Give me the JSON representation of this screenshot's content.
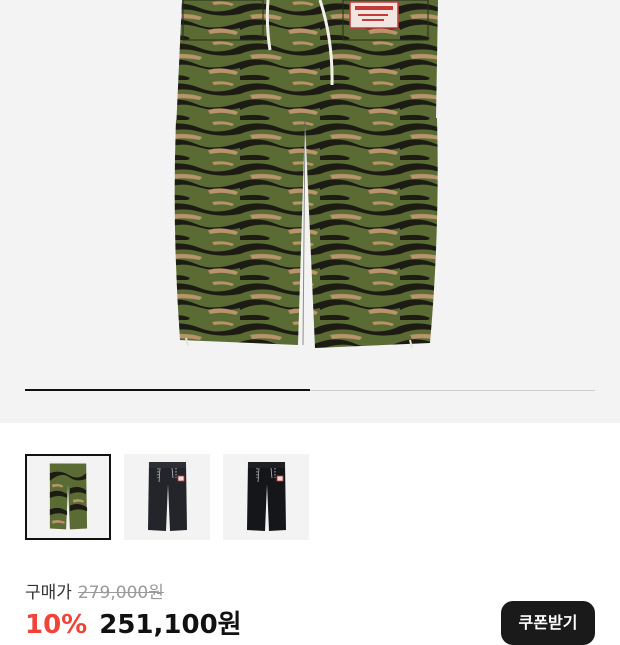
{
  "product": {
    "label_prefix": "구매가",
    "original_price": "279,000원",
    "discount": "10%",
    "sale_price": "251,100원",
    "coupon_label": "쿠폰받기"
  },
  "gallery": {
    "progress": 0.5,
    "thumbnails": [
      {
        "name": "thumb-tiger-camo",
        "selected": true,
        "variant": "camo"
      },
      {
        "name": "thumb-black-pants-1",
        "selected": false,
        "variant": "black"
      },
      {
        "name": "thumb-black-pants-2",
        "selected": false,
        "variant": "black"
      }
    ]
  },
  "colors": {
    "discount": "#f04438",
    "camo_green": "#5b6b34",
    "camo_tan": "#b8946a",
    "camo_black": "#1c1c14"
  }
}
